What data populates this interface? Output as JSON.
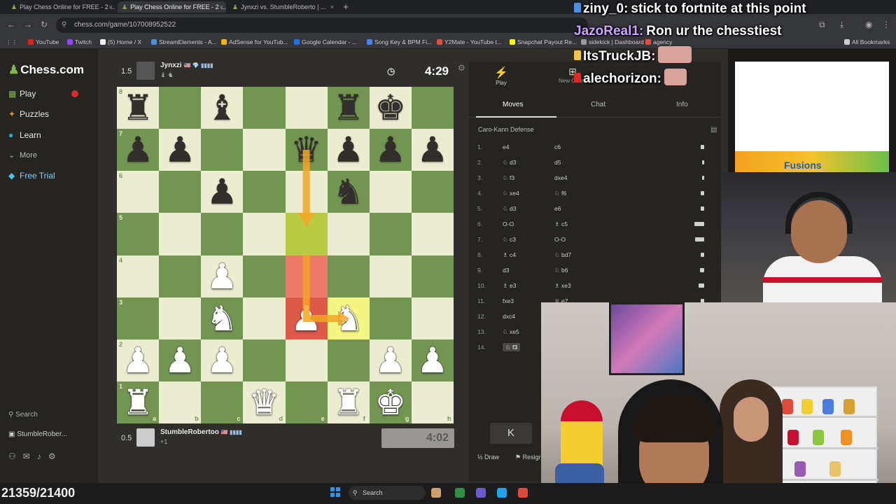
{
  "browser": {
    "tabs": [
      {
        "label": "Play Chess Online for FREE - 2 ..."
      },
      {
        "label": "Play Chess Online for FREE - 2 ..."
      },
      {
        "label": "Jynxzi vs. StumbleRoberto | ..."
      }
    ],
    "url": "chess.com/game/107008952522",
    "bookmarks": [
      {
        "label": "YouTube",
        "color": "#e62117"
      },
      {
        "label": "Twitch",
        "color": "#9146ff"
      },
      {
        "label": "(5) Home / X",
        "color": "#eeeeee"
      },
      {
        "label": "StreamElements - A...",
        "color": "#4a90e2"
      },
      {
        "label": "AdSense for YouTub...",
        "color": "#f4b400"
      },
      {
        "label": "Google Calendar - ...",
        "color": "#1a73e8"
      },
      {
        "label": "Song Key & BPM Fi...",
        "color": "#4285f4"
      },
      {
        "label": "Y2Mate - YouTube t...",
        "color": "#e74c3c"
      },
      {
        "label": "Snapchat Payout Re...",
        "color": "#fffc00"
      },
      {
        "label": "sidekick | Dashboard",
        "color": "#999999"
      },
      {
        "label": "agency",
        "color": "#e74c3c"
      },
      {
        "label": "All Bookmarks",
        "color": "#cccccc"
      }
    ]
  },
  "sidebar": {
    "brand": "Chess.com",
    "items": [
      {
        "label": "Play",
        "icon": "board-icon"
      },
      {
        "label": "Puzzles",
        "icon": "puzzle-icon"
      },
      {
        "label": "Learn",
        "icon": "learn-icon"
      },
      {
        "label": "More",
        "icon": "chevron-down-icon"
      },
      {
        "label": "Free Trial",
        "icon": "diamond-icon"
      }
    ],
    "search_label": "Search",
    "user_label": "StumbleRober...",
    "badge_count": ""
  },
  "game": {
    "top_player": {
      "name": "Jynxzi",
      "rating": "1.5",
      "flags": "🇺🇸 💎 ▮▮▮▮",
      "captured": "♝ ♞"
    },
    "bottom_player": {
      "name": "StumbleRobertoo",
      "rating": "0.5",
      "flags": "🇺🇸 ▮▮▮▮",
      "captured": "+1"
    },
    "top_clock": "4:29",
    "bottom_clock": "4:02",
    "files": [
      "a",
      "b",
      "c",
      "d",
      "e",
      "f",
      "g",
      "h"
    ],
    "ranks": [
      "8",
      "7",
      "6",
      "5",
      "4",
      "3",
      "2",
      "1"
    ]
  },
  "panel": {
    "play_label": "Play",
    "new_game_label": "New Game",
    "tabs": [
      "Moves",
      "Chat",
      "Info"
    ],
    "opening": "Caro-Kann Defense",
    "moves": [
      {
        "n": "1.",
        "w": "e4",
        "b": "c6",
        "t": 0.3
      },
      {
        "n": "2.",
        "w": "♘ d3",
        "b": "d5",
        "t": 0.2
      },
      {
        "n": "3.",
        "w": "♘ f3",
        "b": "dxe4",
        "t": 0.2
      },
      {
        "n": "4.",
        "w": "♘ xe4",
        "b": "♘ f6",
        "t": 0.3
      },
      {
        "n": "5.",
        "w": "♘ d3",
        "b": "e6",
        "t": 0.3
      },
      {
        "n": "6.",
        "w": "O-O",
        "b": "♗ c5",
        "t": 0.9
      },
      {
        "n": "7.",
        "w": "♘ c3",
        "b": "O-O",
        "t": 0.8
      },
      {
        "n": "8.",
        "w": "♗ c4",
        "b": "♘ bd7",
        "t": 0.3
      },
      {
        "n": "9.",
        "w": "d3",
        "b": "♘ b6",
        "t": 0.4
      },
      {
        "n": "10.",
        "w": "♗ e3",
        "b": "♗ xe3",
        "t": 0.5
      },
      {
        "n": "11.",
        "w": "fxe3",
        "b": "♕ e7",
        "t": 0.3
      },
      {
        "n": "12.",
        "w": "dxc4",
        "b": "",
        "t": 0.3
      },
      {
        "n": "13.",
        "w": "♘ xe5",
        "b": "",
        "t": 0.3
      },
      {
        "n": "14.",
        "w": "♘ f3",
        "b": "",
        "t": 0.3
      }
    ],
    "nav_label": "K",
    "draw_label": "Draw",
    "resign_label": "Resign"
  },
  "stream": {
    "chat": [
      {
        "user": "ziny_0:",
        "text": "stick to fortnite at this point",
        "color": "#ffffff",
        "badge": "#4a90e2"
      },
      {
        "user": "JazoReal1:",
        "text": "Ron ur the chesstiest",
        "color": "#c9a7ff",
        "badge": ""
      },
      {
        "user": "ItsTruckJB:",
        "text": "",
        "color": "#ffffff",
        "badge": "#f5c542"
      },
      {
        "user": "alechorizon:",
        "text": "",
        "color": "#ffffff",
        "badge": "#e02828"
      }
    ],
    "ad_text": "Fusions",
    "view_counter": "21359/21400"
  },
  "taskbar": {
    "search_label": "Search"
  }
}
